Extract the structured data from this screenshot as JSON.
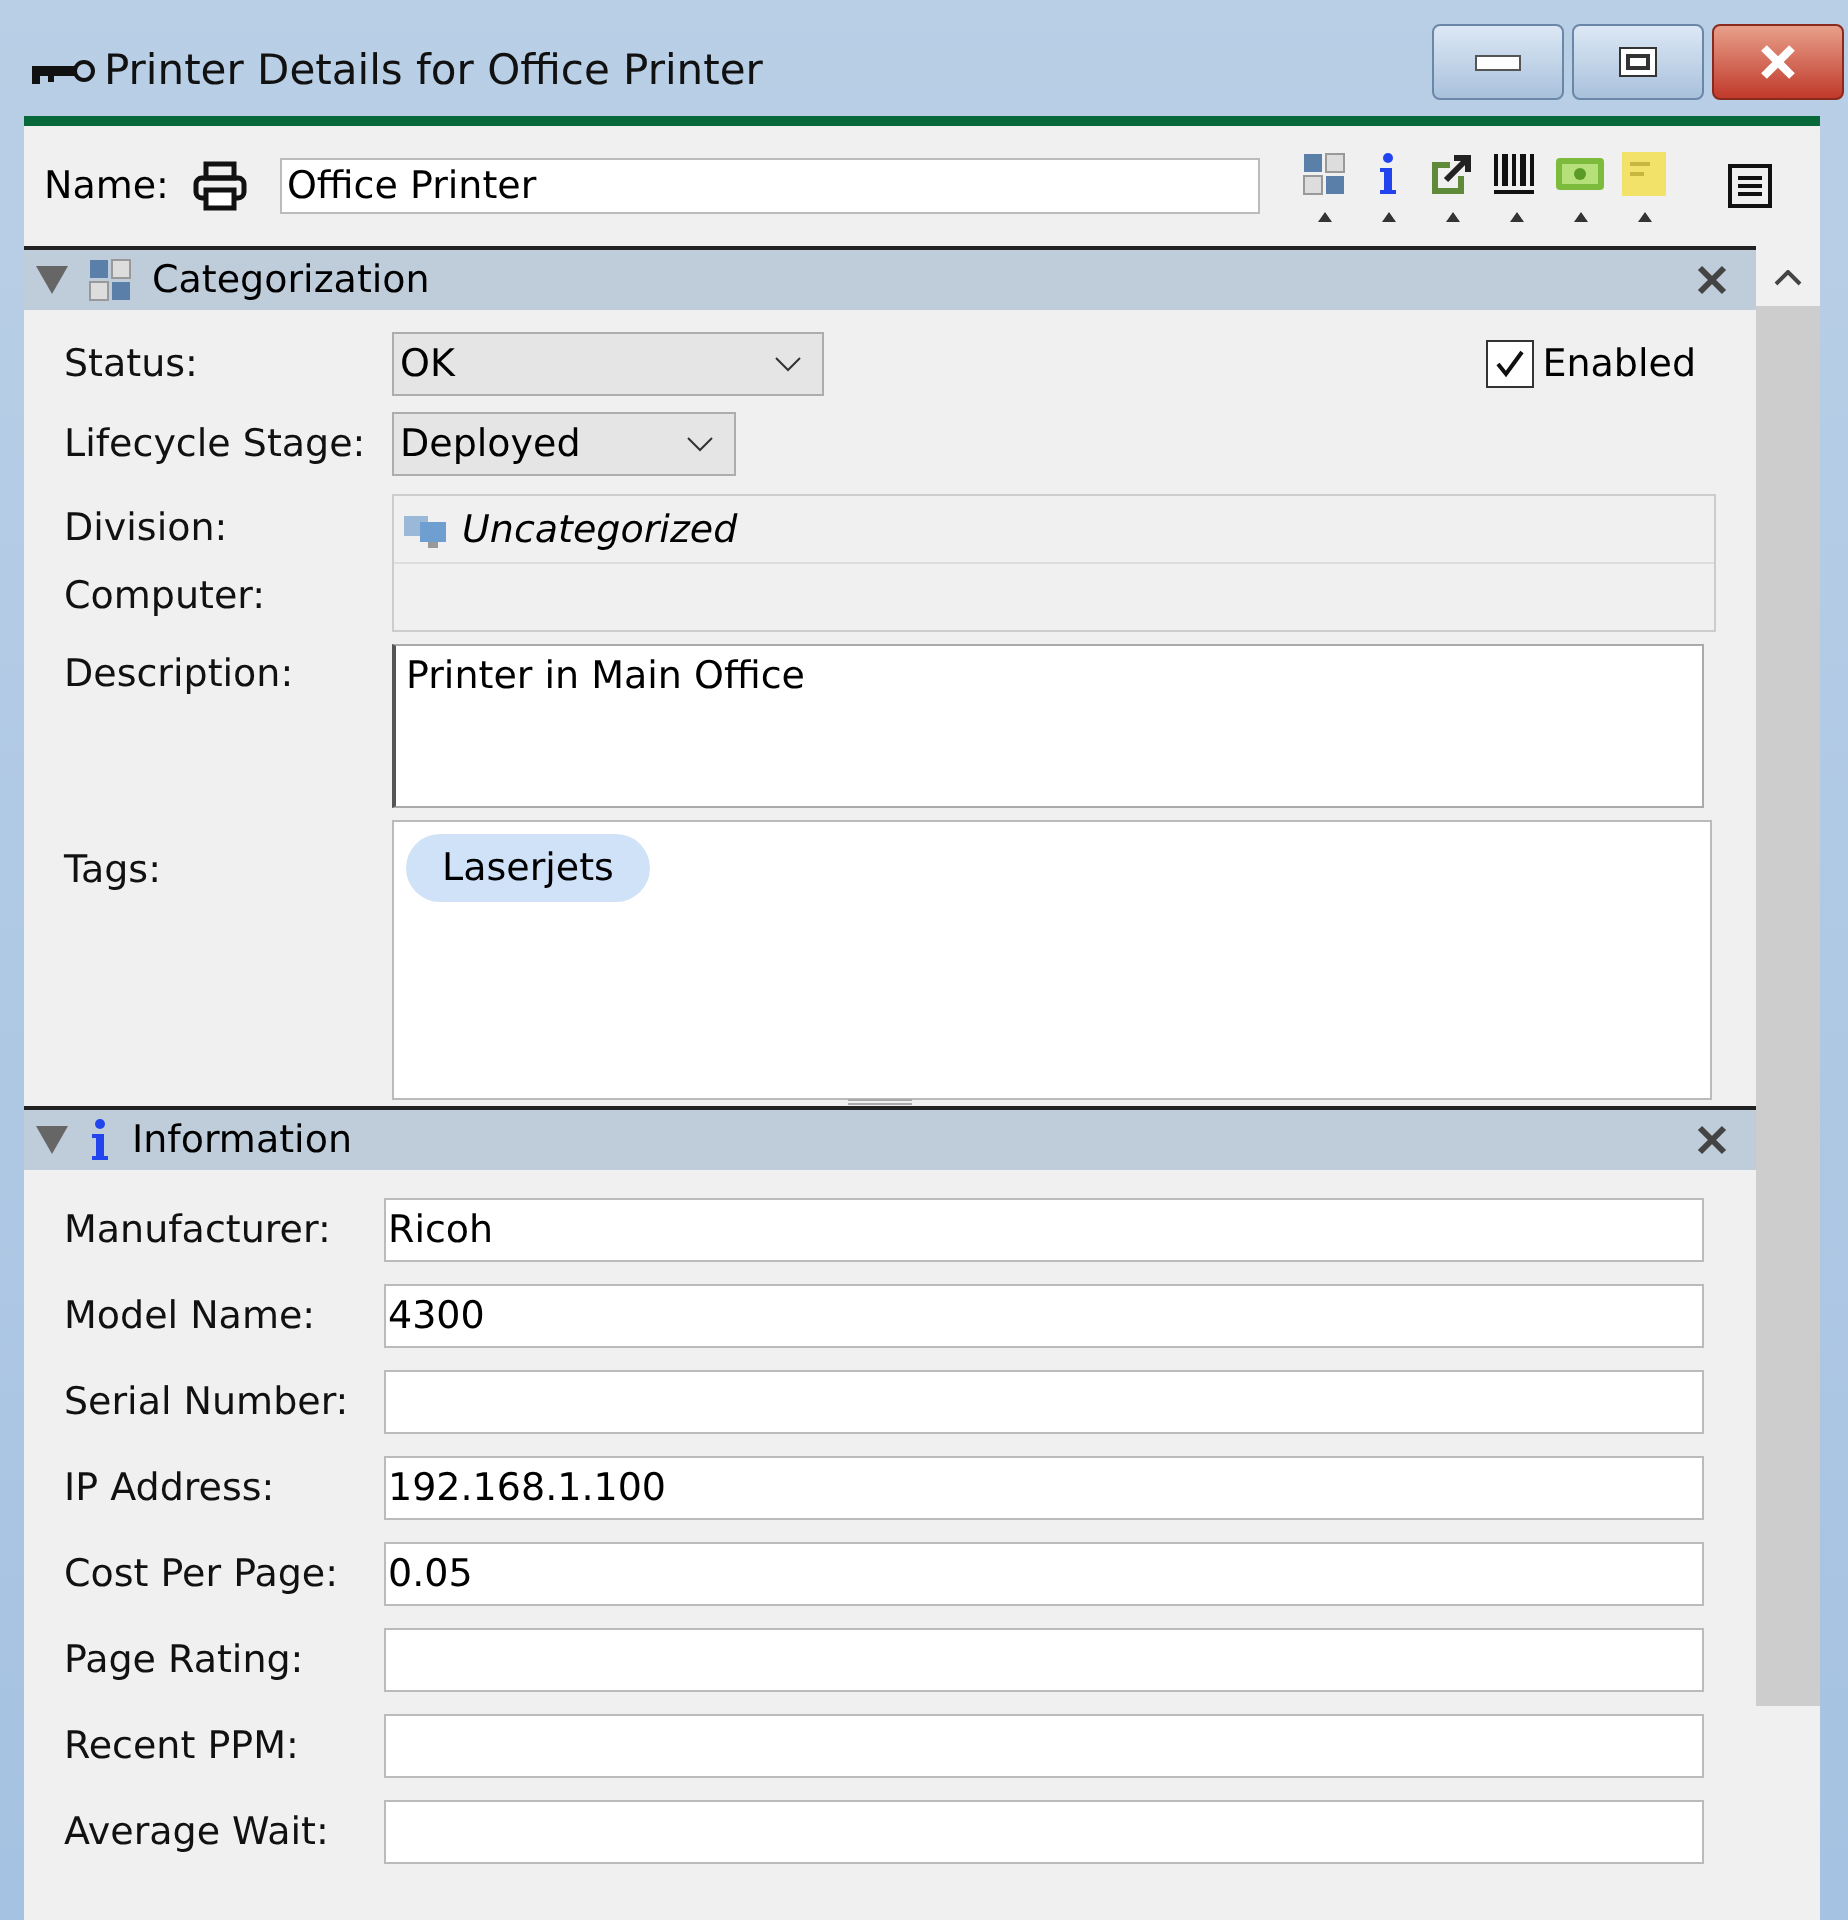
{
  "window": {
    "title": "Printer Details for Office Printer"
  },
  "name_field": {
    "label": "Name:",
    "value": "Office Printer"
  },
  "toolbar_icons": [
    {
      "kind": "grid"
    },
    {
      "kind": "info"
    },
    {
      "kind": "external"
    },
    {
      "kind": "barcode"
    },
    {
      "kind": "money"
    },
    {
      "kind": "note"
    }
  ],
  "categorization": {
    "title": "Categorization",
    "expanded": true,
    "status": {
      "label": "Status:",
      "value": "OK"
    },
    "enabled": {
      "label": "Enabled",
      "checked": true
    },
    "lifecycle": {
      "label": "Lifecycle Stage:",
      "value": "Deployed"
    },
    "division": {
      "label": "Division:",
      "value": "Uncategorized"
    },
    "computer": {
      "label": "Computer:"
    },
    "description": {
      "label": "Description:",
      "value": "Printer in Main Office"
    },
    "tags": {
      "label": "Tags:",
      "items": [
        "Laserjets"
      ]
    }
  },
  "information": {
    "title": "Information",
    "expanded": true,
    "fields": [
      {
        "label": "Manufacturer:",
        "value": "Ricoh"
      },
      {
        "label": "Model Name:",
        "value": "4300"
      },
      {
        "label": "Serial Number:"
      },
      {
        "label": "IP Address:",
        "value": "192.168.1.100"
      },
      {
        "label": "Cost Per Page:",
        "value": "0.05"
      },
      {
        "label": "Page Rating:"
      },
      {
        "label": "Recent PPM:"
      },
      {
        "label": "Average Wait:"
      }
    ]
  }
}
